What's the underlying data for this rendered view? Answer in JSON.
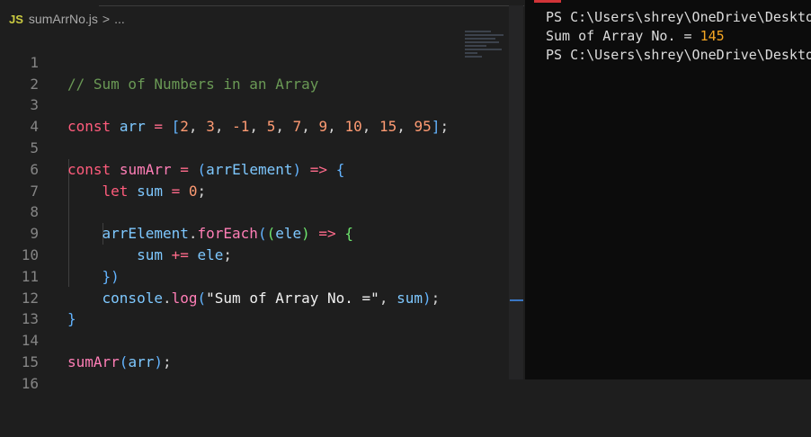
{
  "breadcrumb": {
    "lang_badge": "JS",
    "file_name": "sumArrNo.js",
    "separator": ">",
    "more": "..."
  },
  "editor": {
    "line_numbers": [
      "1",
      "2",
      "3",
      "4",
      "5",
      "6",
      "7",
      "8",
      "9",
      "10",
      "11",
      "12",
      "13",
      "14",
      "15",
      "16"
    ],
    "lines": [
      "// Sum of Numbers in an Array",
      "",
      "const arr = [2, 3, -1, 5, 7, 9, 10, 15, 95];",
      "",
      "const sumArr = (arrElement) => {",
      "    let sum = 0;",
      "",
      "    arrElement.forEach((ele) => {",
      "        sum += ele;",
      "    })",
      "    console.log(\"Sum of Array No. =\", sum);",
      "}",
      "",
      "sumArr(arr);",
      "",
      ""
    ]
  },
  "terminal": {
    "line1": "PS C:\\Users\\shrey\\OneDrive\\Desktop",
    "output_label": "Sum of Array No. = ",
    "output_value": "145",
    "line3": "PS C:\\Users\\shrey\\OneDrive\\Desktop"
  },
  "colors": {
    "keyword": "#ff5c7c",
    "variable": "#7ec8ff",
    "function": "#ff7eb6",
    "number": "#ff9b73",
    "comment": "#6a9955",
    "terminal_number": "#f5a623"
  }
}
